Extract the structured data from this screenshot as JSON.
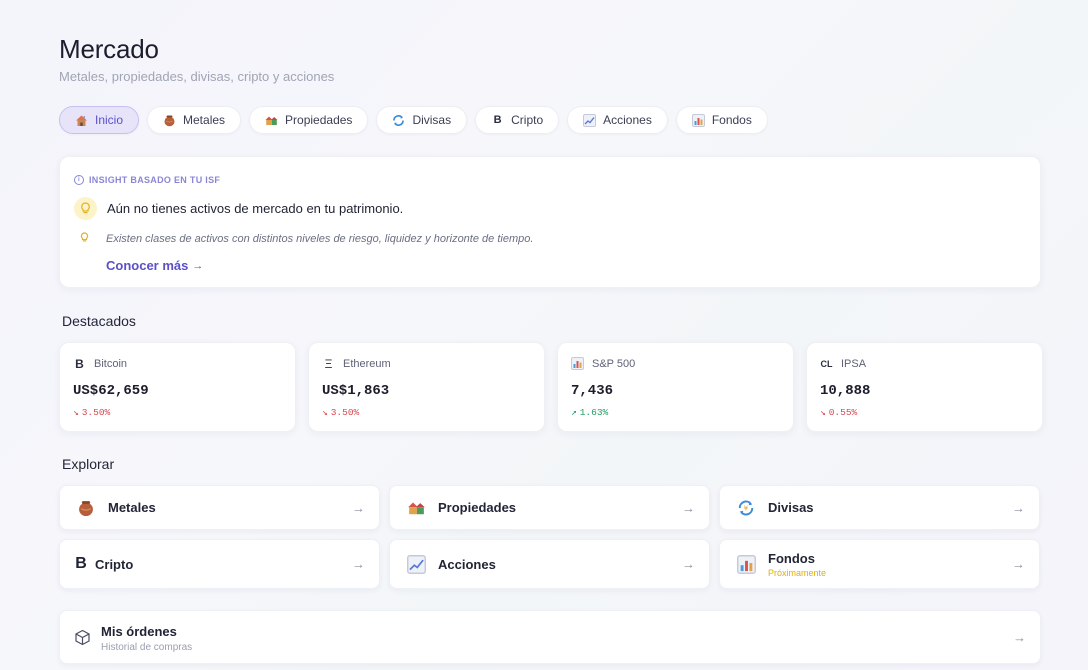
{
  "header": {
    "title": "Mercado",
    "subtitle": "Metales, propiedades, divisas, cripto y acciones"
  },
  "tabs": [
    {
      "label": "Inicio",
      "icon": "house-icon",
      "active": true
    },
    {
      "label": "Metales",
      "icon": "gold-pot-icon",
      "active": false
    },
    {
      "label": "Propiedades",
      "icon": "houses-icon",
      "active": false
    },
    {
      "label": "Divisas",
      "icon": "currency-exchange-icon",
      "active": false
    },
    {
      "label": "Cripto",
      "icon": "bitcoin-icon",
      "active": false
    },
    {
      "label": "Acciones",
      "icon": "chart-up-icon",
      "active": false
    },
    {
      "label": "Fondos",
      "icon": "bar-chart-icon",
      "active": false
    }
  ],
  "insight": {
    "heading": "INSIGHT BASADO EN TU ISF",
    "message": "Aún no tienes activos de mercado en tu patrimonio.",
    "detail": "Existen clases de activos con distintos niveles de riesgo, liquidez y horizonte de tiempo.",
    "link": "Conocer más"
  },
  "featured": {
    "title": "Destacados",
    "items": [
      {
        "icon_text": "B",
        "name": "Bitcoin",
        "price": "US$62,659",
        "change": "3.50%",
        "direction": "down"
      },
      {
        "icon_text": "Ξ",
        "name": "Ethereum",
        "price": "US$1,863",
        "change": "3.50%",
        "direction": "down"
      },
      {
        "icon_text": "",
        "name": "S&P 500",
        "price": "7,436",
        "change": "1.63%",
        "direction": "up"
      },
      {
        "icon_text": "CL",
        "name": "IPSA",
        "price": "10,888",
        "change": "0.55%",
        "direction": "down"
      }
    ]
  },
  "explore": {
    "title": "Explorar",
    "items": [
      {
        "label": "Metales",
        "icon": "gold-pot-icon",
        "note": ""
      },
      {
        "label": "Propiedades",
        "icon": "houses-icon",
        "note": ""
      },
      {
        "label": "Divisas",
        "icon": "currency-exchange-icon",
        "note": ""
      },
      {
        "label": "Cripto",
        "icon": "bitcoin-icon",
        "note": ""
      },
      {
        "label": "Acciones",
        "icon": "chart-up-icon",
        "note": ""
      },
      {
        "label": "Fondos",
        "icon": "bar-chart-icon",
        "note": "Próximamente"
      }
    ]
  },
  "orders": {
    "title": "Mis órdenes",
    "subtitle": "Historial de compras"
  },
  "colors": {
    "accent": "#5b50c9",
    "active_tab_bg": "#e7e4fa",
    "down": "#d8474f",
    "up": "#1f9a62",
    "soon": "#e0b000"
  }
}
